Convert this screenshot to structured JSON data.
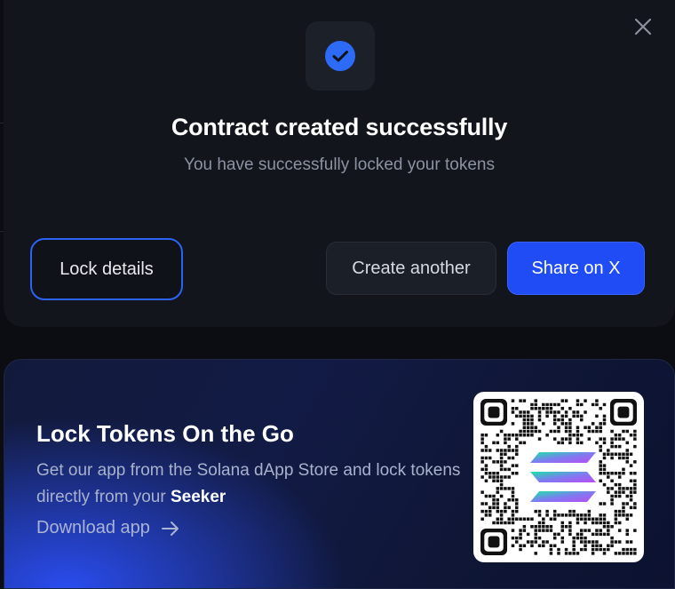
{
  "modal": {
    "title": "Contract created successfully",
    "subtitle": "You have successfully locked your tokens",
    "buttons": {
      "lock_details": "Lock details",
      "create_another": "Create another",
      "share": "Share on X"
    },
    "icons": {
      "close": "close-icon",
      "success": "check-circle-icon"
    },
    "colors": {
      "accent": "#1f4cf5",
      "check": "#2d6af6",
      "background": "#12151c"
    }
  },
  "promo": {
    "title": "Lock Tokens On the Go",
    "description_prefix": "Get our app from the Solana dApp Store and lock tokens directly from your",
    "description_emphasis": "Seeker",
    "download_label": "Download app",
    "qr_icon": "solana-logo-icon"
  }
}
